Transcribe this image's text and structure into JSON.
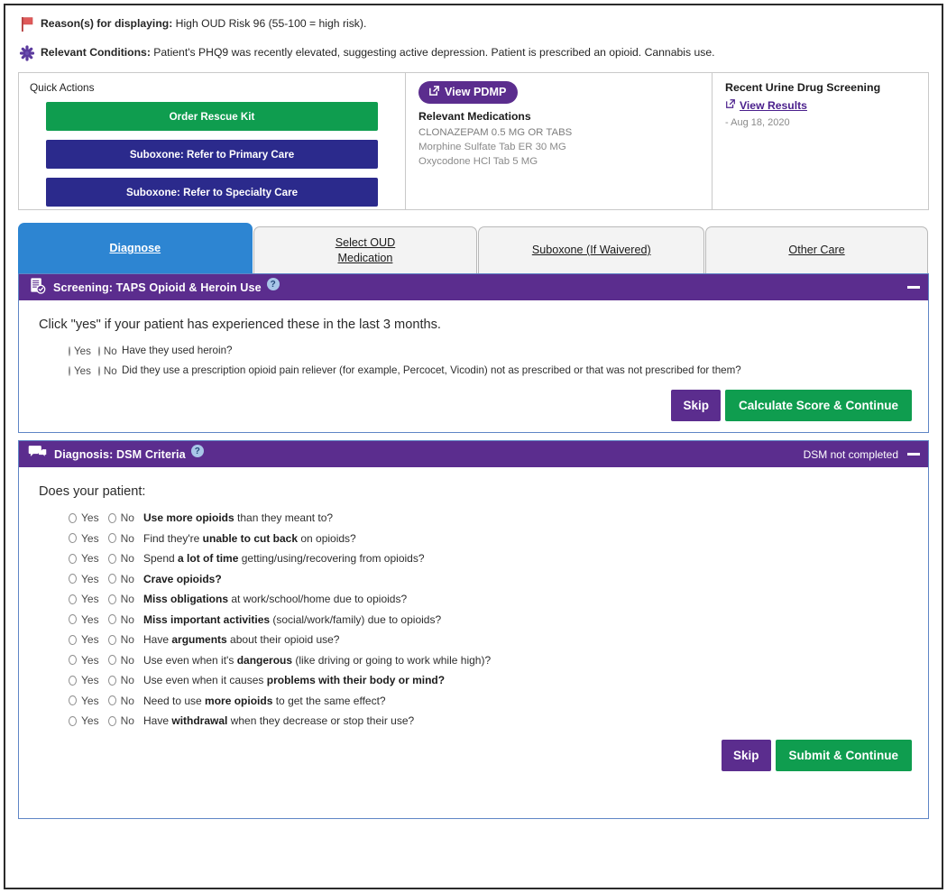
{
  "alerts": [
    {
      "icon": "flag-icon",
      "label": "Reason(s) for displaying:",
      "text": " High OUD Risk 96 (55-100 = high risk)."
    },
    {
      "icon": "asterisk-icon",
      "label": "Relevant Conditions:",
      "text": " Patient's PHQ9 was recently elevated, suggesting active depression. Patient is prescribed an opioid. Cannabis use."
    }
  ],
  "quick_actions": {
    "title": "Quick Actions",
    "buttons": [
      {
        "label": "Order Rescue Kit",
        "style": "green"
      },
      {
        "label": "Suboxone: Refer to Primary Care",
        "style": "navy"
      },
      {
        "label": "Suboxone: Refer to Specialty Care",
        "style": "navy"
      }
    ]
  },
  "medications": {
    "pdmp_button": "View PDMP",
    "title": "Relevant Medications",
    "items": [
      "CLONAZEPAM 0.5 MG OR TABS",
      "Morphine Sulfate Tab ER 30 MG",
      "Oxycodone HCl Tab 5 MG"
    ]
  },
  "urine_screening": {
    "title": "Recent Urine Drug Screening",
    "link": "View Results",
    "date": "- Aug 18, 2020"
  },
  "tabs": [
    {
      "label": "Diagnose",
      "active": true
    },
    {
      "label": "Select OUD\nMedication",
      "active": false
    },
    {
      "label": "Suboxone (If Waivered)",
      "active": false
    },
    {
      "label": "Other Care",
      "active": false
    }
  ],
  "screening": {
    "icon": "clipboard-check-icon",
    "title": "Screening: TAPS Opioid & Heroin Use",
    "help": "?",
    "collapse": "minus-icon",
    "prompt": "Click \"yes\" if your patient has experienced these in the last 3 months.",
    "yes_label": "Yes",
    "no_label": "No",
    "questions": [
      {
        "plain": "Have they used heroin?"
      },
      {
        "plain": "Did they use a prescription opioid pain reliever (for example, Percocet, Vicodin) not as prescribed or that was not prescribed for them?"
      }
    ],
    "skip_label": "Skip",
    "submit_label": "Calculate Score & Continue"
  },
  "diagnosis": {
    "icon": "speech-bubbles-icon",
    "title": "Diagnosis: DSM Criteria",
    "help": "?",
    "status": "DSM not completed",
    "collapse": "minus-icon",
    "prompt": "Does your patient:",
    "yes_label": "Yes",
    "no_label": "No",
    "questions": [
      {
        "bold": "Use more opioids",
        "rest": " than they meant to?"
      },
      {
        "pre": "Find they're ",
        "bold": "unable to cut back",
        "rest": " on opioids?"
      },
      {
        "pre": "Spend ",
        "bold": "a lot of time",
        "rest": " getting/using/recovering from opioids?"
      },
      {
        "bold": "Crave opioids?",
        "rest": ""
      },
      {
        "bold": "Miss obligations",
        "rest": " at work/school/home due to opioids?"
      },
      {
        "bold": "Miss important activities",
        "rest": " (social/work/family) due to opioids?"
      },
      {
        "pre": "Have ",
        "bold": "arguments",
        "rest": " about their opioid use?"
      },
      {
        "pre": "Use even when it's ",
        "bold": "dangerous",
        "rest": " (like driving or going to work while high)?"
      },
      {
        "pre": "Use even when it causes ",
        "bold": "problems with their body or mind?",
        "rest": ""
      },
      {
        "pre": "Need to use ",
        "bold": "more opioids",
        "rest": " to get the same effect?"
      },
      {
        "pre": "Have ",
        "bold": "withdrawal",
        "rest": " when they decrease or stop their use?"
      }
    ],
    "skip_label": "Skip",
    "submit_label": "Submit & Continue"
  },
  "colors": {
    "purple": "#5b2d8e",
    "navy": "#2b2a8c",
    "green": "#0f9d4f",
    "tab_active_blue": "#2d85d2",
    "panel_border_blue": "#5f86c6",
    "flag_red": "#d13b3b"
  }
}
